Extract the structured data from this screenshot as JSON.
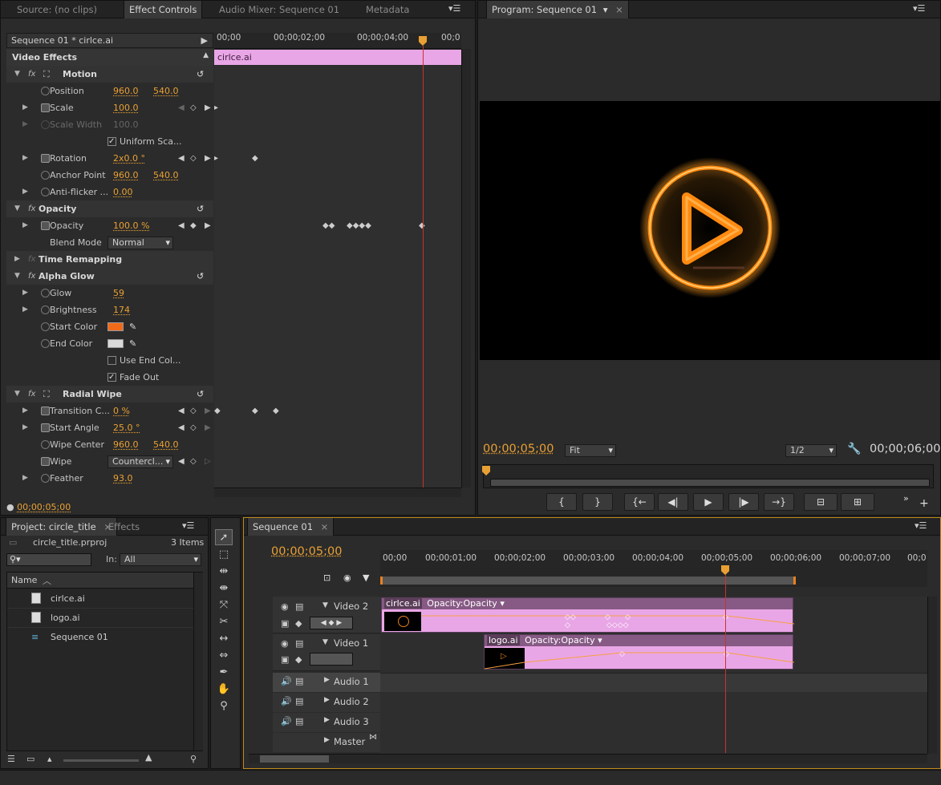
{
  "effect_panel": {
    "tabs": [
      "Source: (no clips)",
      "Effect Controls",
      "Audio Mixer: Sequence 01",
      "Metadata"
    ],
    "header": "Sequence 01 * cirlce.ai",
    "ruler": [
      "00;00",
      "00;00;02;00",
      "00;00;04;00",
      "00;0"
    ],
    "clip_name": "cirlce.ai",
    "section_title": "Video Effects",
    "timecode": "00;00;05;00",
    "rows": [
      {
        "label": "Motion",
        "group": true
      },
      {
        "label": "Position",
        "v1": "960.0",
        "v2": "540.0"
      },
      {
        "label": "Scale",
        "v1": "100.0"
      },
      {
        "label": "Scale Width",
        "v1": "100.0"
      },
      {
        "label": "Uniform Sca..."
      },
      {
        "label": "Rotation",
        "v1": "2x0.0 °"
      },
      {
        "label": "Anchor Point",
        "v1": "960.0",
        "v2": "540.0"
      },
      {
        "label": "Anti-flicker ...",
        "v1": "0.00"
      },
      {
        "label": "Opacity",
        "group": true
      },
      {
        "label": "Opacity",
        "v1": "100.0 %"
      },
      {
        "label": "Blend Mode",
        "v1": "Normal"
      },
      {
        "label": "Time Remapping",
        "group": true
      },
      {
        "label": "Alpha Glow",
        "group": true
      },
      {
        "label": "Glow",
        "v1": "59"
      },
      {
        "label": "Brightness",
        "v1": "174"
      },
      {
        "label": "Start Color"
      },
      {
        "label": "End Color"
      },
      {
        "label": "Use End Col..."
      },
      {
        "label": "Fade Out"
      },
      {
        "label": "Radial Wipe",
        "group": true
      },
      {
        "label": "Transition C...",
        "v1": "0 %"
      },
      {
        "label": "Start Angle",
        "v1": "25.0 °"
      },
      {
        "label": "Wipe Center",
        "v1": "960.0",
        "v2": "540.0"
      },
      {
        "label": "Wipe",
        "v1": "Countercl..."
      },
      {
        "label": "Feather",
        "v1": "93.0"
      }
    ],
    "colors": {
      "start_color": "#f06a1a",
      "end_color": "#d9d9d9"
    }
  },
  "program": {
    "tab": "Program: Sequence 01",
    "timecode_current": "00;00;05;00",
    "fit": "Fit",
    "resolution": "1/2",
    "timecode_duration": "00;00;06;00",
    "controls": [
      "{",
      "}",
      "{←",
      "◀|",
      "▶",
      "|▶",
      "→}"
    ]
  },
  "project": {
    "tabs": [
      "Project: circle_title",
      "Effects"
    ],
    "file": "circle_title.prproj",
    "count": "3 Items",
    "in_label": "In:",
    "in_value": "All",
    "col_name": "Name",
    "items": [
      "cirlce.ai",
      "logo.ai",
      "Sequence 01"
    ]
  },
  "timeline": {
    "tab": "Sequence 01",
    "timecode": "00;00;05;00",
    "ruler": [
      "00;00",
      "00;00;01;00",
      "00;00;02;00",
      "00;00;03;00",
      "00;00;04;00",
      "00;00;05;00",
      "00;00;06;00",
      "00;00;07;00",
      "00;0"
    ],
    "tracks": [
      "Video 2",
      "Video 1",
      "Audio 1",
      "Audio 2",
      "Audio 3",
      "Master"
    ],
    "clip1": {
      "name": "cirlce.ai",
      "fx": "Opacity:Opacity"
    },
    "clip2": {
      "name": "logo.ai",
      "fx": "Opacity:Opacity"
    }
  }
}
